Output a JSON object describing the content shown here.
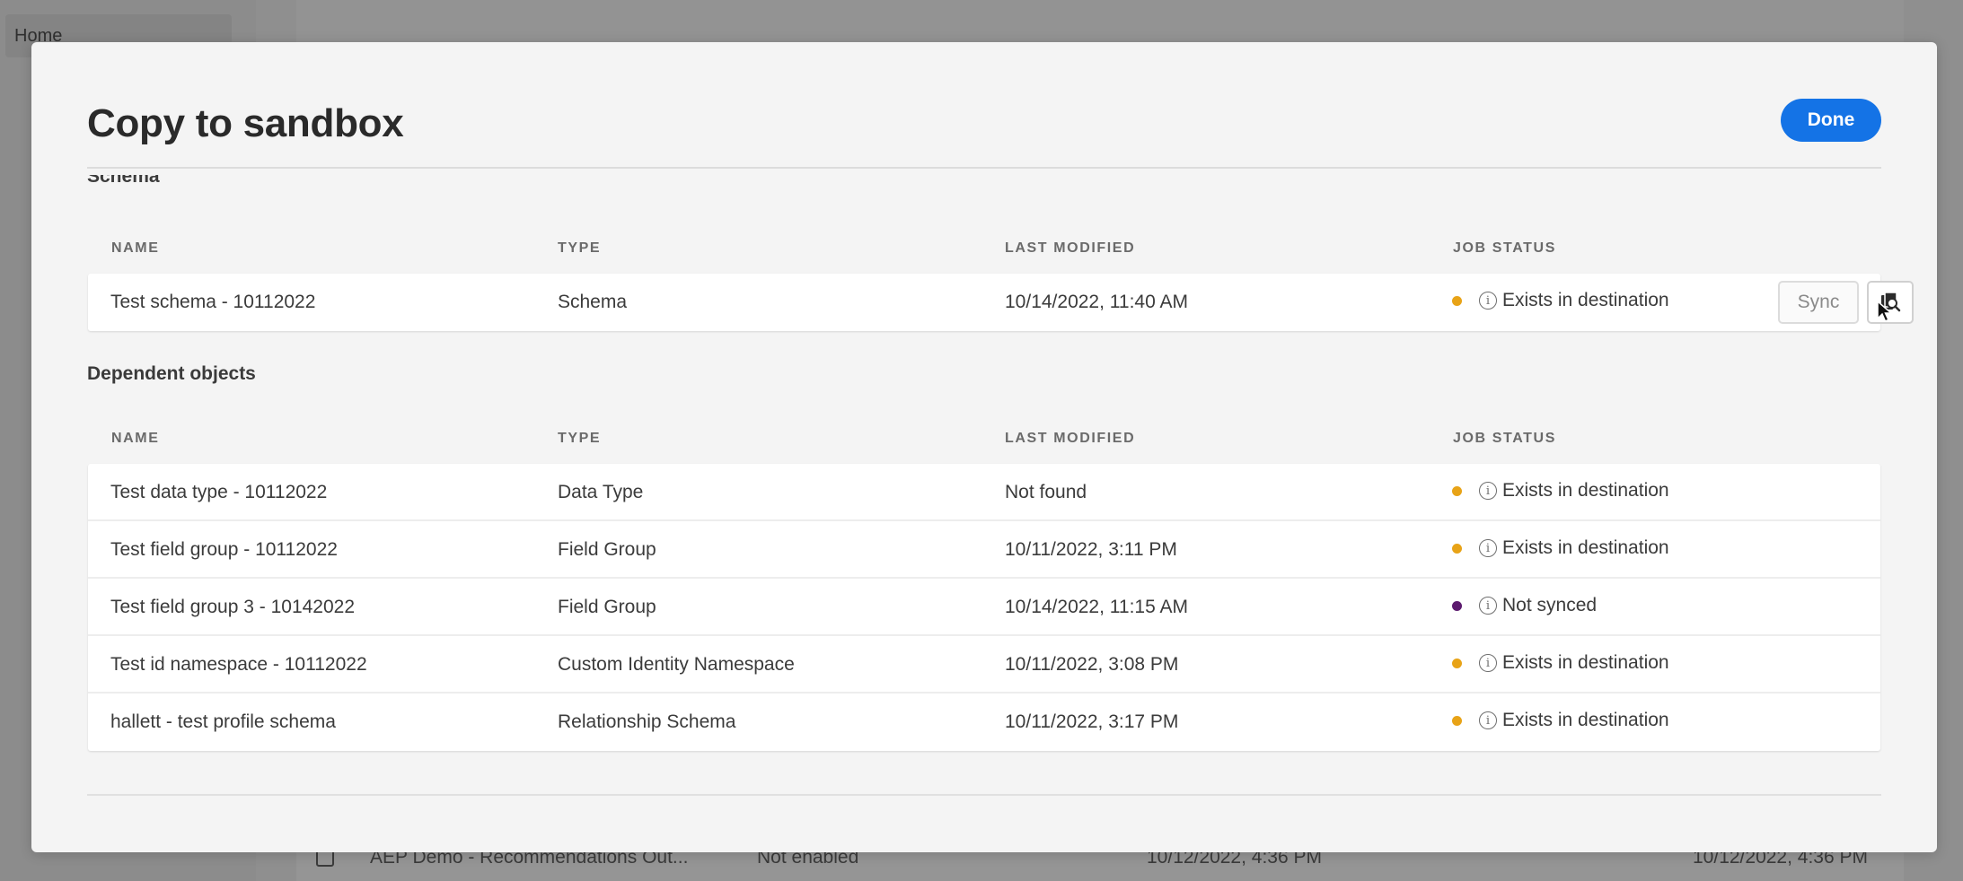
{
  "background": {
    "sidebar_home": "Home",
    "row": {
      "name": "AEP Demo - Recommendations Out...",
      "status": "Not enabled",
      "created": "10/12/2022, 4:36 PM",
      "modified": "10/12/2022, 4:36 PM"
    }
  },
  "modal": {
    "title": "Copy to sandbox",
    "done_label": "Done",
    "schema_section_label": "Schema",
    "dependent_section_label": "Dependent objects",
    "columns": {
      "name": "NAME",
      "type": "TYPE",
      "last_modified": "LAST MODIFIED",
      "job_status": "JOB STATUS"
    },
    "schema_rows": [
      {
        "name": "Test schema - 10112022",
        "type": "Schema",
        "last_modified": "10/14/2022, 11:40 AM",
        "status": "Exists in destination",
        "status_color": "#e8a317",
        "sync_label": "Sync"
      }
    ],
    "dependent_rows": [
      {
        "name": "Test data type - 10112022",
        "type": "Data Type",
        "last_modified": "Not found",
        "status": "Exists in destination",
        "status_color": "#e8a317"
      },
      {
        "name": "Test field group - 10112022",
        "type": "Field Group",
        "last_modified": "10/11/2022, 3:11 PM",
        "status": "Exists in destination",
        "status_color": "#e8a317"
      },
      {
        "name": "Test field group 3 - 10142022",
        "type": "Field Group",
        "last_modified": "10/14/2022, 11:15 AM",
        "status": "Not synced",
        "status_color": "#5c1a6e"
      },
      {
        "name": "Test id namespace - 10112022",
        "type": "Custom Identity Namespace",
        "last_modified": "10/11/2022, 3:08 PM",
        "status": "Exists in destination",
        "status_color": "#e8a317"
      },
      {
        "name": "hallett - test profile schema",
        "type": "Relationship Schema",
        "last_modified": "10/11/2022, 3:17 PM",
        "status": "Exists in destination",
        "status_color": "#e8a317"
      }
    ],
    "icons": {
      "info": "info-icon",
      "preview": "copy-preview-icon",
      "cursor": "mouse-cursor-icon"
    },
    "accent_color": "#1473e6"
  }
}
